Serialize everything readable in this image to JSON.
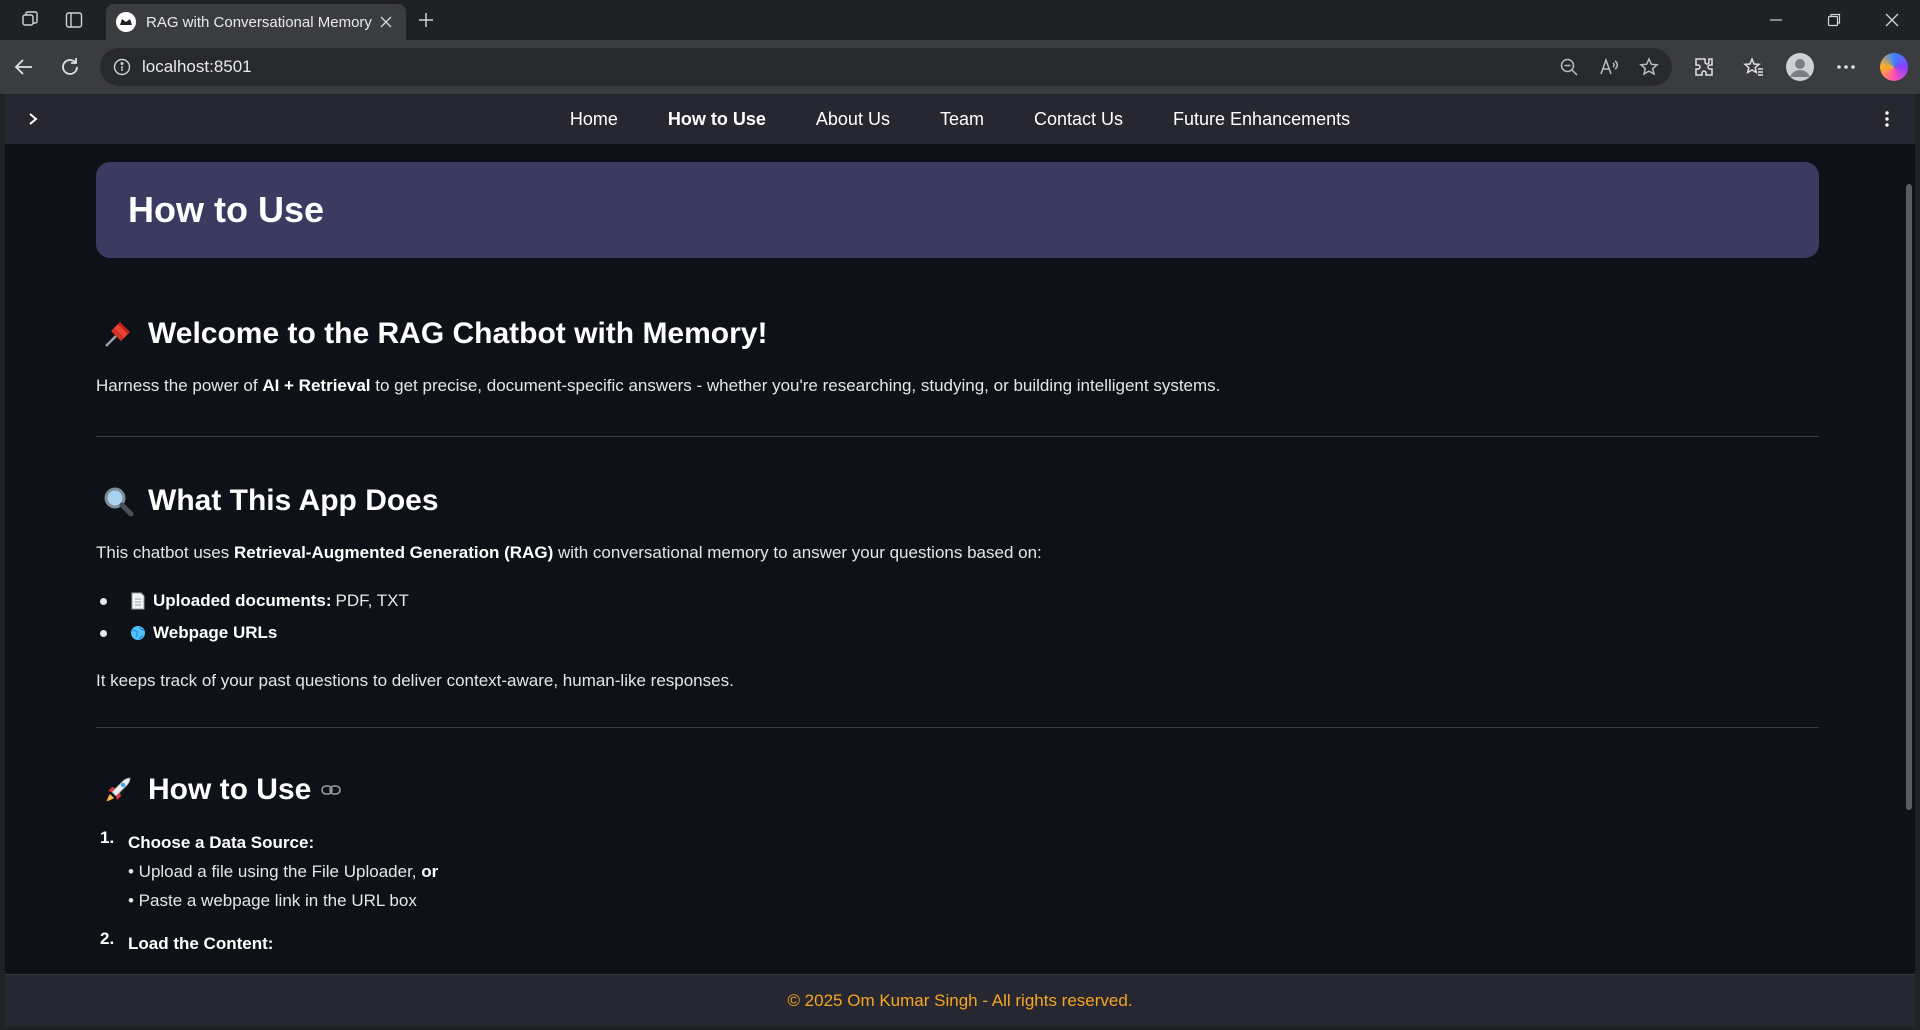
{
  "browser": {
    "tab_title": "RAG with Conversational Memory",
    "url": "localhost:8501"
  },
  "topnav": {
    "links": [
      {
        "label": "Home",
        "active": false
      },
      {
        "label": "How to Use",
        "active": true
      },
      {
        "label": "About Us",
        "active": false
      },
      {
        "label": "Team",
        "active": false
      },
      {
        "label": "Contact Us",
        "active": false
      },
      {
        "label": "Future Enhancements",
        "active": false
      }
    ]
  },
  "banner": {
    "title": "How to Use"
  },
  "welcome": {
    "heading": "Welcome to the RAG Chatbot with Memory!",
    "text_pre": "Harness the power of ",
    "text_bold": "AI + Retrieval",
    "text_post": " to get precise, document-specific answers - whether you're researching, studying, or building intelligent systems."
  },
  "what": {
    "heading": "What This App Does",
    "text_pre": "This chatbot uses ",
    "text_bold": "Retrieval-Augmented Generation (RAG)",
    "text_post": " with conversational memory to answer your questions based on:",
    "bullets": [
      {
        "bold": "Uploaded documents:",
        "text": "PDF, TXT",
        "icon": "document-icon"
      },
      {
        "bold": "Webpage URLs",
        "text": "",
        "icon": "globe-icon"
      }
    ],
    "closing": "It keeps track of your past questions to deliver context-aware, human-like responses."
  },
  "howto": {
    "heading": "How to Use",
    "steps": [
      {
        "num": "1.",
        "title": "Choose a Data Source:",
        "line1_pre": "• Upload a file using the File Uploader, ",
        "line1_bold": "or",
        "line2": "• Paste a webpage link in the URL box"
      },
      {
        "num": "2.",
        "title": "Load the Content:"
      }
    ]
  },
  "footer": {
    "text": "© 2025 Om Kumar Singh - All rights reserved."
  },
  "colors": {
    "page_bg": "#0e1117",
    "nav_bg": "#262730",
    "banner_bg": "#3b3a61",
    "footer_text": "#f5a623"
  }
}
